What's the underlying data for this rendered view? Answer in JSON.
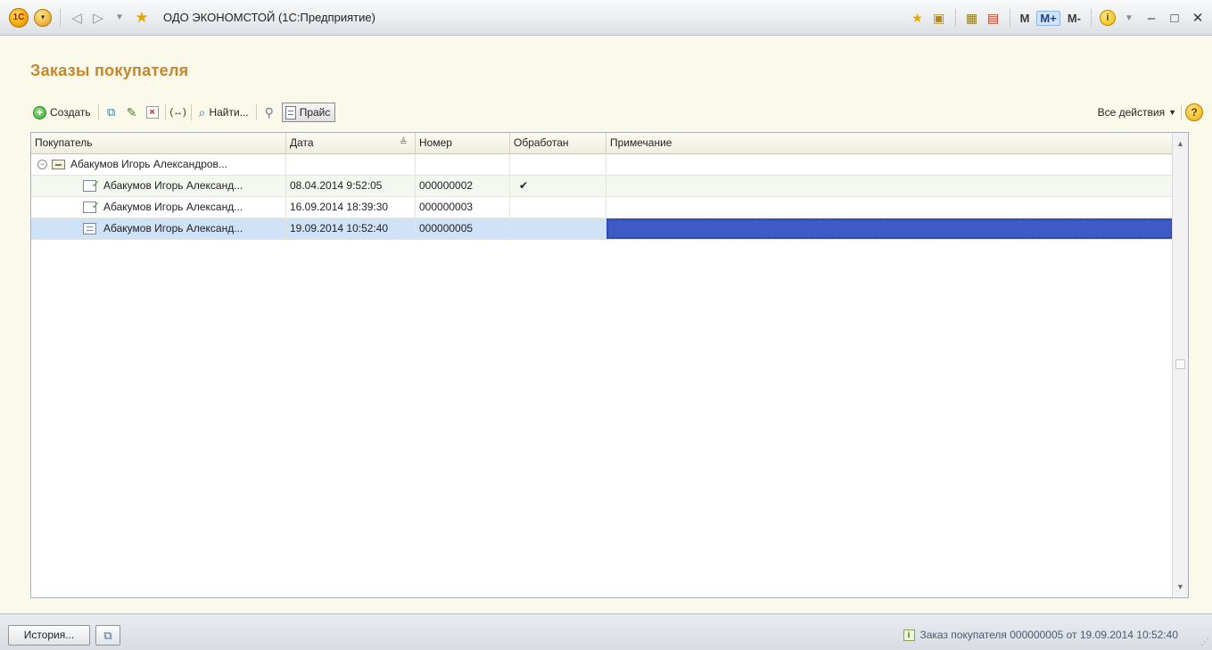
{
  "titlebar": {
    "app_title": "ОДО ЭКОНОМСТОЙ (1С:Предприятие)",
    "logo_text": "1С",
    "m_label": "M",
    "m_plus_label": "M+",
    "m_minus_label": "M-"
  },
  "form": {
    "title": "Заказы покупателя",
    "toolbar": {
      "create_label": "Создать",
      "find_label": "Найти...",
      "price_label": "Прайс",
      "all_actions_label": "Все действия"
    }
  },
  "table": {
    "columns": [
      "Покупатель",
      "Дата",
      "Номер",
      "Обработан",
      "Примечание"
    ],
    "group_row": {
      "buyer": "Абакумов Игорь Александров..."
    },
    "rows": [
      {
        "buyer": "Абакумов Игорь Александ...",
        "date": "08.04.2014 9:52:05",
        "number": "000000002",
        "processed": "✔",
        "note": "",
        "icon": "posted-document-icon"
      },
      {
        "buyer": "Абакумов Игорь Александ...",
        "date": "16.09.2014 18:39:30",
        "number": "000000003",
        "processed": "",
        "note": "",
        "icon": "posted-document-icon"
      },
      {
        "buyer": "Абакумов Игорь Александ...",
        "date": "19.09.2014 10:52:40",
        "number": "000000005",
        "processed": "",
        "note": "",
        "icon": "document-icon"
      }
    ]
  },
  "statusbar": {
    "history_label": "История...",
    "message": "Заказ покупателя 000000005 от 19.09.2014 10:52:40"
  },
  "colors": {
    "title_accent": "#c8862a",
    "form_background": "#fbf9e9",
    "selected_row": "#cfe3f8",
    "selected_cell": "#3e5ac4"
  }
}
